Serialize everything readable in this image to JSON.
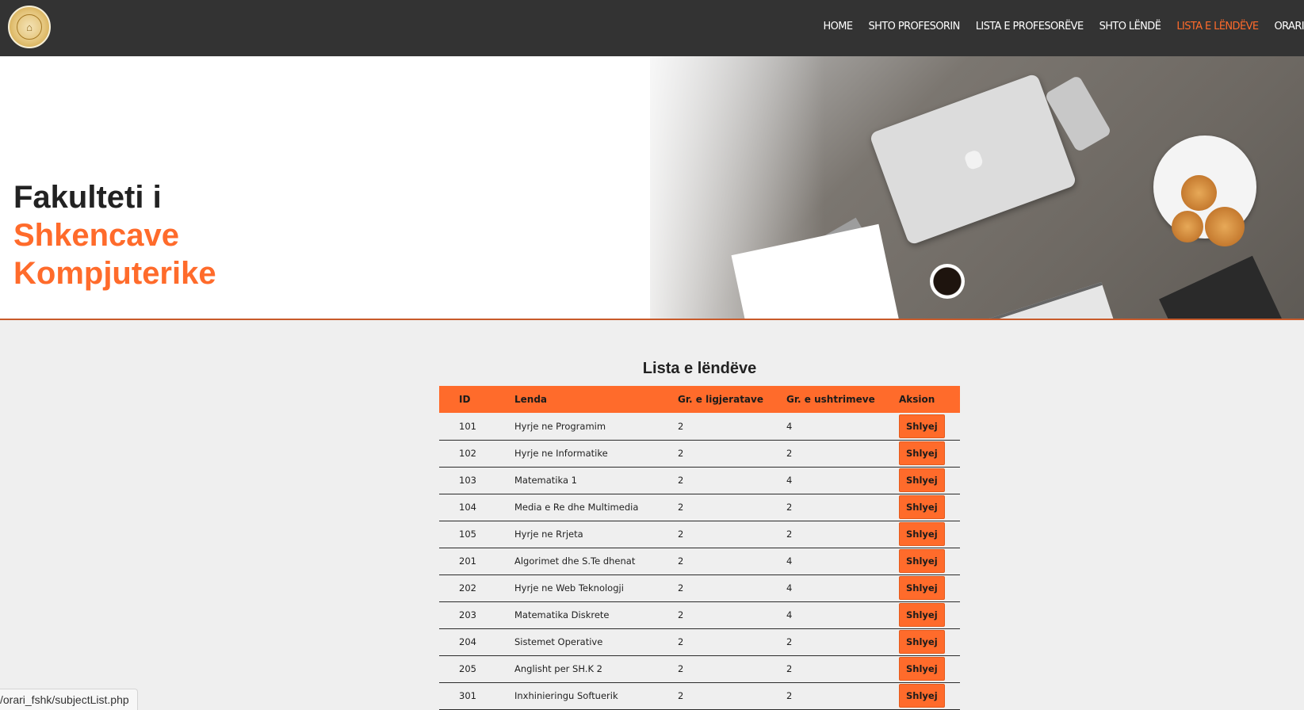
{
  "nav": {
    "logo_icon": "university-seal-logo",
    "items": [
      {
        "label": "HOME",
        "active": false
      },
      {
        "label": "SHTO PROFESORIN",
        "active": false
      },
      {
        "label": "LISTA E PROFESORËVE",
        "active": false
      },
      {
        "label": "SHTO LËNDË",
        "active": false
      },
      {
        "label": "LISTA E LËNDËVE",
        "active": true
      },
      {
        "label": "ORARI",
        "active": false
      }
    ]
  },
  "hero": {
    "line1": "Fakulteti i",
    "line2": "Shkencave",
    "line3": "Kompjuterike"
  },
  "subjects": {
    "title": "Lista e lëndëve",
    "columns": [
      "ID",
      "Lenda",
      "Gr. e ligjeratave",
      "Gr. e ushtrimeve",
      "Aksion"
    ],
    "action_label": "Shlyej",
    "rows": [
      {
        "id": "101",
        "name": "Hyrje ne Programim",
        "lectures": "2",
        "exercises": "4"
      },
      {
        "id": "102",
        "name": "Hyrje ne Informatike",
        "lectures": "2",
        "exercises": "2"
      },
      {
        "id": "103",
        "name": "Matematika 1",
        "lectures": "2",
        "exercises": "4"
      },
      {
        "id": "104",
        "name": "Media e Re dhe Multimedia",
        "lectures": "2",
        "exercises": "2"
      },
      {
        "id": "105",
        "name": "Hyrje ne Rrjeta",
        "lectures": "2",
        "exercises": "2"
      },
      {
        "id": "201",
        "name": "Algorimet dhe S.Te dhenat",
        "lectures": "2",
        "exercises": "4"
      },
      {
        "id": "202",
        "name": "Hyrje ne Web Teknologji",
        "lectures": "2",
        "exercises": "4"
      },
      {
        "id": "203",
        "name": "Matematika Diskrete",
        "lectures": "2",
        "exercises": "4"
      },
      {
        "id": "204",
        "name": "Sistemet Operative",
        "lectures": "2",
        "exercises": "2"
      },
      {
        "id": "205",
        "name": "Anglisht per SH.K 2",
        "lectures": "2",
        "exercises": "2"
      },
      {
        "id": "301",
        "name": "Inxhinieringu Softuerik",
        "lectures": "2",
        "exercises": "2"
      }
    ]
  },
  "status_url": "/orari_fshk/subjectList.php",
  "colors": {
    "accent": "#ff6b2b",
    "navbar": "#333333",
    "background": "#efefef"
  }
}
